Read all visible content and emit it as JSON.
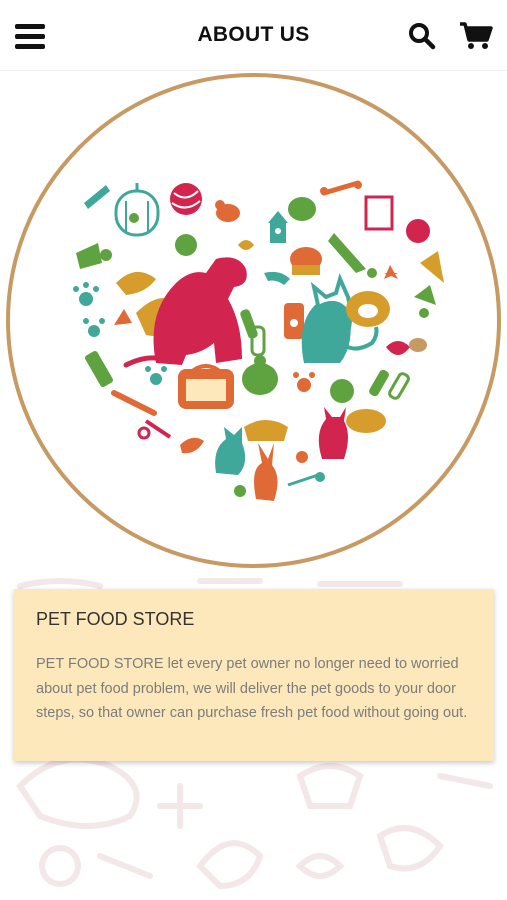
{
  "header": {
    "title": "ABOUT US",
    "icons": [
      "menu-icon",
      "search-icon",
      "cart-icon"
    ]
  },
  "hero": {
    "image": "pet-heart-illustration",
    "ring_color": "#c79a63"
  },
  "about": {
    "heading": "PET FOOD STORE",
    "body": "PET FOOD STORE let every pet owner no longer need to worried about pet food problem, we will deliver the pet goods to your door steps, so that owner can purchase fresh pet food without going out.",
    "card_color": "#fde8bb"
  },
  "colors": {
    "red": "#d1254f",
    "teal": "#3fa89a",
    "green": "#5fa340",
    "orange": "#e06a36",
    "tan": "#c79a63",
    "gold": "#d79d2c"
  }
}
